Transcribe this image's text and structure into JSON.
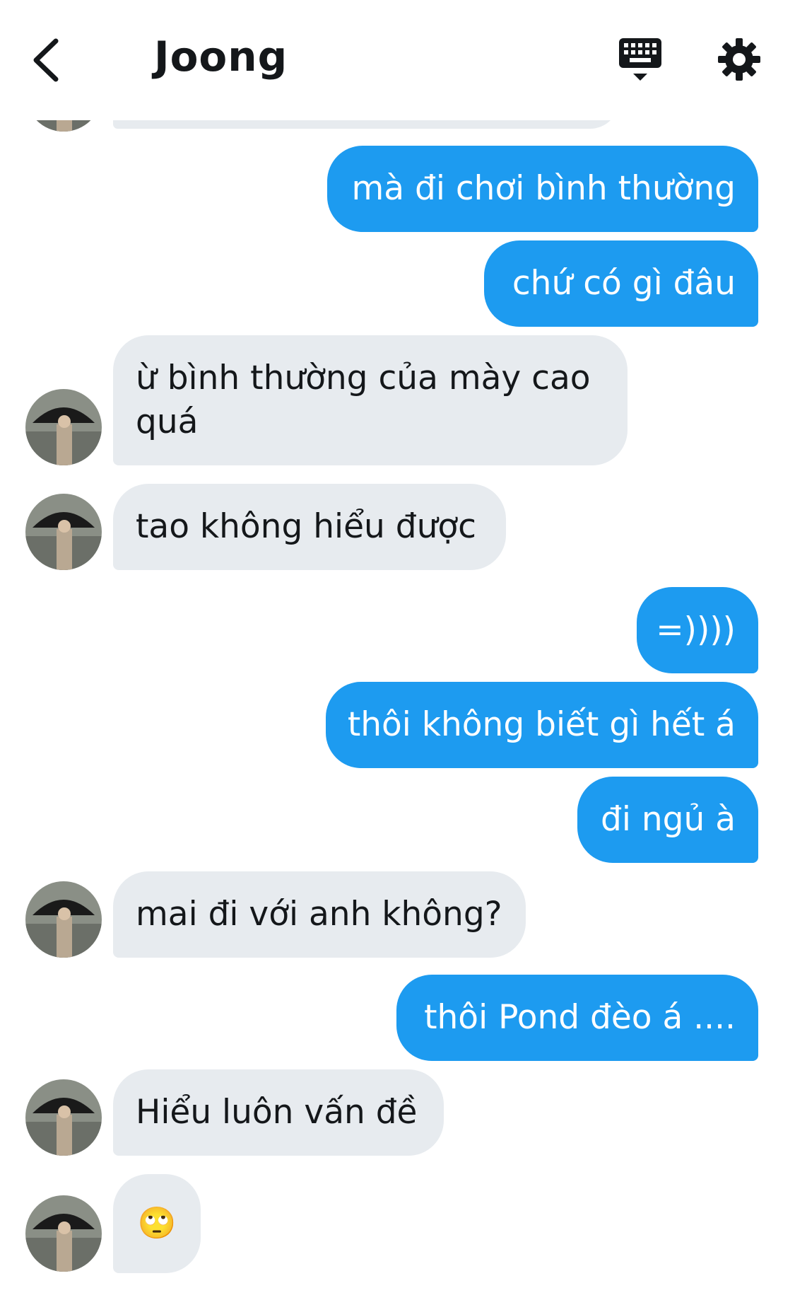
{
  "header": {
    "title": "Joong",
    "back_icon": "chevron-left-icon",
    "keyboard_icon": "keyboard-icon",
    "settings_icon": "gear-icon"
  },
  "colors": {
    "outgoing_bubble": "#1d9bf0",
    "incoming_bubble": "#e7ebef",
    "text_dark": "#14171a"
  },
  "messages": [
    {
      "direction": "out",
      "text": "mà đi chơi bình thường"
    },
    {
      "direction": "out",
      "text": "chứ có gì đâu"
    },
    {
      "direction": "in",
      "text": "ừ bình thường của mày cao quá"
    },
    {
      "direction": "in",
      "text": "tao không hiểu được"
    },
    {
      "direction": "out",
      "text": "=))))"
    },
    {
      "direction": "out",
      "text": "thôi không biết gì hết á"
    },
    {
      "direction": "out",
      "text": "đi ngủ à"
    },
    {
      "direction": "in",
      "text": "mai đi với anh không?"
    },
    {
      "direction": "out",
      "text": "thôi Pond đèo á ...."
    },
    {
      "direction": "in",
      "text": "Hiểu luôn vấn đề"
    },
    {
      "direction": "in",
      "text": "🙄"
    }
  ]
}
